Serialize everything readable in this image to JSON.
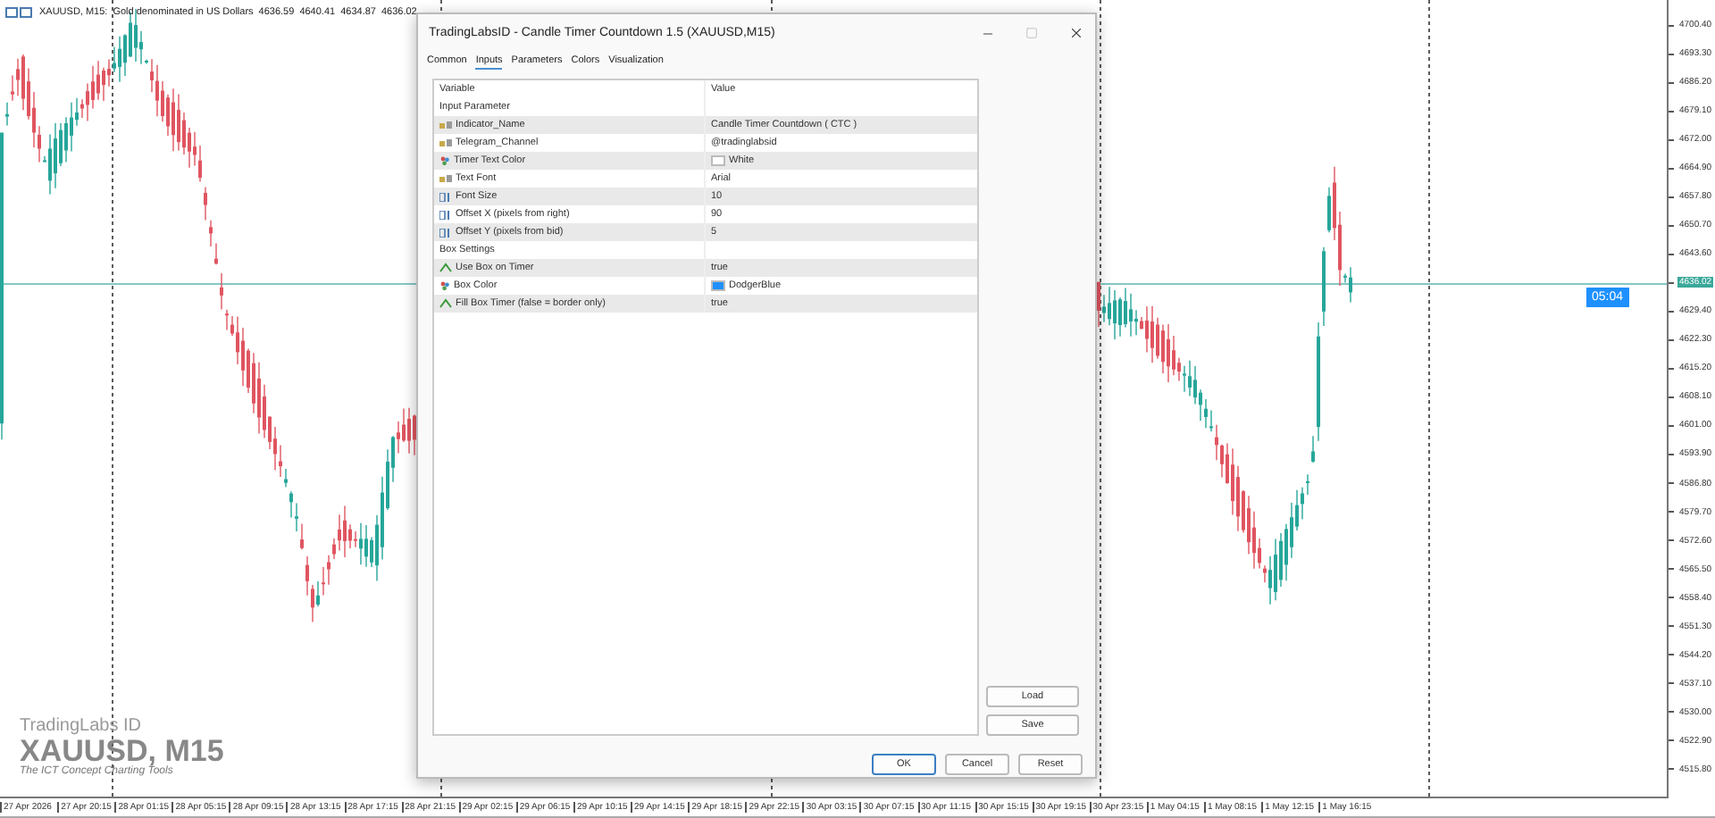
{
  "chart": {
    "symbol_bar": {
      "symbol": "XAUUSD, M15:",
      "description": "Gold denominated in US Dollars",
      "ohlc": [
        "4636.59",
        "4640.41",
        "4634.87",
        "4636.02"
      ]
    },
    "timer": "05:04",
    "price_axis": [
      {
        "label": "4700.40",
        "current": false
      },
      {
        "label": "4693.30",
        "current": false
      },
      {
        "label": "4686.20",
        "current": false
      },
      {
        "label": "4679.10",
        "current": false
      },
      {
        "label": "4672.00",
        "current": false
      },
      {
        "label": "4664.90",
        "current": false
      },
      {
        "label": "4657.80",
        "current": false
      },
      {
        "label": "4650.70",
        "current": false
      },
      {
        "label": "4643.60",
        "current": false
      },
      {
        "label": "4636.02",
        "current": true
      },
      {
        "label": "4629.40",
        "current": false
      },
      {
        "label": "4622.30",
        "current": false
      },
      {
        "label": "4615.20",
        "current": false
      },
      {
        "label": "4608.10",
        "current": false
      },
      {
        "label": "4601.00",
        "current": false
      },
      {
        "label": "4593.90",
        "current": false
      },
      {
        "label": "4586.80",
        "current": false
      },
      {
        "label": "4579.70",
        "current": false
      },
      {
        "label": "4572.60",
        "current": false
      },
      {
        "label": "4565.50",
        "current": false
      },
      {
        "label": "4558.40",
        "current": false
      },
      {
        "label": "4551.30",
        "current": false
      },
      {
        "label": "4544.20",
        "current": false
      },
      {
        "label": "4537.10",
        "current": false
      },
      {
        "label": "4530.00",
        "current": false
      },
      {
        "label": "4522.90",
        "current": false
      },
      {
        "label": "4515.80",
        "current": false
      }
    ],
    "time_axis": [
      "27 Apr 2026",
      "27 Apr 20:15",
      "28 Apr 01:15",
      "28 Apr 05:15",
      "28 Apr 09:15",
      "28 Apr 13:15",
      "28 Apr 17:15",
      "28 Apr 21:15",
      "29 Apr 02:15",
      "29 Apr 06:15",
      "29 Apr 10:15",
      "29 Apr 14:15",
      "29 Apr 18:15",
      "29 Apr 22:15",
      "30 Apr 03:15",
      "30 Apr 07:15",
      "30 Apr 11:15",
      "30 Apr 15:15",
      "30 Apr 19:15",
      "30 Apr 23:15",
      "1 May 04:15",
      "1 May 08:15",
      "1 May 12:15",
      "1 May 16:15"
    ],
    "watermark": {
      "brand": "TradingLabs ID",
      "title": "XAUUSD, M15",
      "tagline": "The ICT Concept Charting Tools"
    }
  },
  "dialog": {
    "title": "TradingLabsID - Candle Timer Countdown 1.5 (XAUUSD,M15)",
    "tabs": [
      {
        "label": "Common",
        "selected": false
      },
      {
        "label": "Inputs",
        "selected": true
      },
      {
        "label": "Parameters",
        "selected": false
      },
      {
        "label": "Colors",
        "selected": false
      },
      {
        "label": "Visualization",
        "selected": false
      }
    ],
    "table": {
      "columns": [
        "Variable",
        "Value"
      ],
      "rows": [
        {
          "kind": "group",
          "variable": "Input Parameter"
        },
        {
          "kind": "string",
          "variable": "Indicator_Name",
          "value": "Candle Timer Countdown ( CTC )"
        },
        {
          "kind": "string",
          "variable": "Telegram_Channel",
          "value": "@tradinglabsid"
        },
        {
          "kind": "color",
          "variable": "Timer Text Color",
          "value": "White",
          "color": "#ffffff"
        },
        {
          "kind": "string",
          "variable": "Text Font",
          "value": "Arial"
        },
        {
          "kind": "int",
          "variable": "Font Size",
          "value": "10"
        },
        {
          "kind": "int",
          "variable": "Offset X (pixels from right)",
          "value": "90"
        },
        {
          "kind": "int",
          "variable": "Offset Y (pixels from bid)",
          "value": "5"
        },
        {
          "kind": "group",
          "variable": "Box Settings"
        },
        {
          "kind": "bool",
          "variable": "Use Box on Timer",
          "value": "true"
        },
        {
          "kind": "color",
          "variable": "Box Color",
          "value": "DodgerBlue",
          "color": "#1e90ff"
        },
        {
          "kind": "bool",
          "variable": "Fill Box Timer (false = border only)",
          "value": "true"
        }
      ]
    },
    "side_buttons": [
      "Load",
      "Save"
    ],
    "buttons": [
      {
        "label": "OK",
        "default": true
      },
      {
        "label": "Cancel",
        "default": false
      },
      {
        "label": "Reset",
        "default": false
      }
    ]
  }
}
